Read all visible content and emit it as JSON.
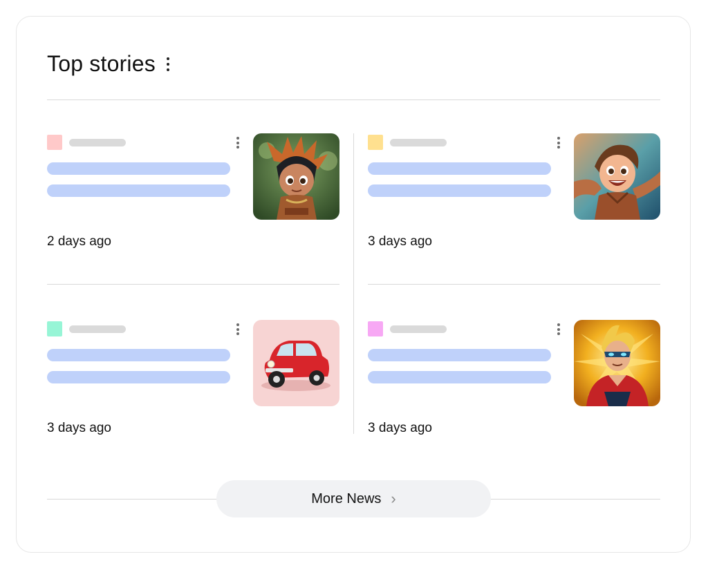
{
  "header": {
    "title": "Top stories",
    "menu_icon": "more-vert-icon"
  },
  "stories": [
    {
      "source_color": "#ffc9c9",
      "time": "2 days ago",
      "thumbnail": "tribal-child-cartoon"
    },
    {
      "source_color": "#ffe08f",
      "time": "3 days ago",
      "thumbnail": "happy-boy-cartoon"
    },
    {
      "source_color": "#97f5d6",
      "time": "3 days ago",
      "thumbnail": "red-mini-car"
    },
    {
      "source_color": "#f7a8f4",
      "time": "3 days ago",
      "thumbnail": "superhero-cartoon"
    }
  ],
  "footer": {
    "more_label": "More News",
    "more_icon": "chevron-right-icon"
  },
  "colors": {
    "placeholder_line": "#bfd1fa",
    "placeholder_source": "#dadada",
    "divider": "#d9d9d9"
  }
}
